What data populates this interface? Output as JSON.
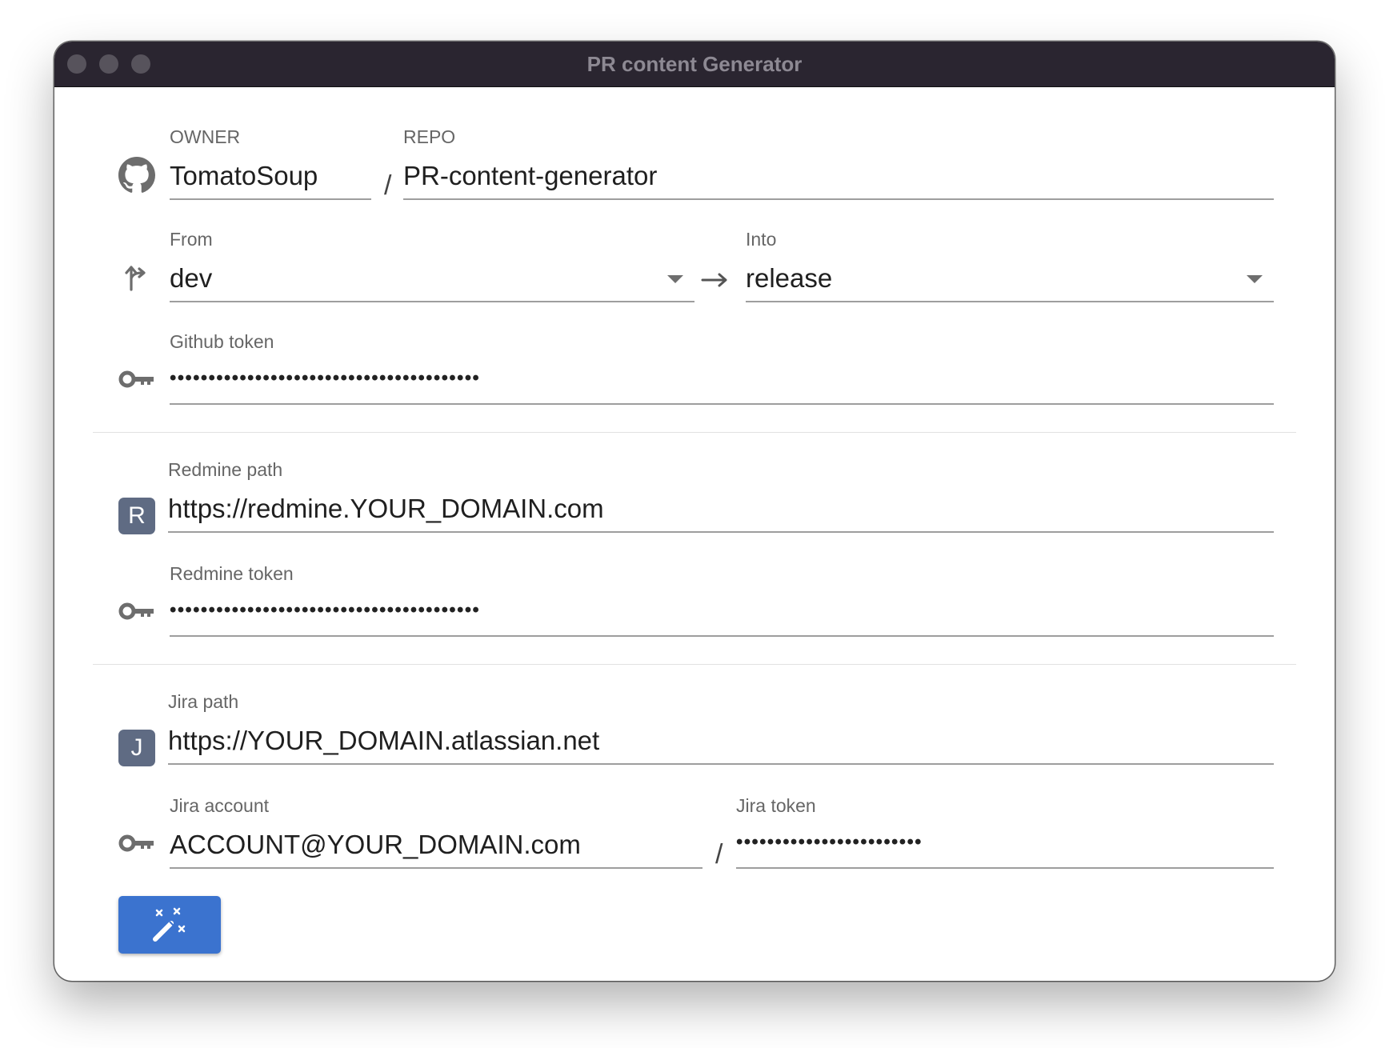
{
  "window": {
    "title": "PR content Generator"
  },
  "github": {
    "icon": "github-icon",
    "owner": {
      "label": "OWNER",
      "value": "TomatoSoup"
    },
    "separator": "/",
    "repo": {
      "label": "REPO",
      "value": "PR-content-generator"
    }
  },
  "branches": {
    "icon": "branch-merge-icon",
    "from": {
      "label": "From",
      "value": "dev"
    },
    "arrow_icon": "arrow-right-icon",
    "into": {
      "label": "Into",
      "value": "release"
    }
  },
  "github_token": {
    "icon": "key-icon",
    "label": "Github token",
    "masked_value": "••••••••••••••••••••••••••••••••••••••••"
  },
  "redmine": {
    "avatar_letter": "R",
    "path": {
      "label": "Redmine path",
      "value": "https://redmine.YOUR_DOMAIN.com"
    },
    "token": {
      "icon": "key-icon",
      "label": "Redmine token",
      "masked_value": "••••••••••••••••••••••••••••••••••••••••"
    }
  },
  "jira": {
    "avatar_letter": "J",
    "path": {
      "label": "Jira path",
      "value": "https://YOUR_DOMAIN.atlassian.net"
    },
    "account": {
      "icon": "key-icon",
      "label": "Jira account",
      "value": "ACCOUNT@YOUR_DOMAIN.com"
    },
    "separator": "/",
    "token": {
      "label": "Jira token",
      "masked_value": "••••••••••••••••••••••••"
    }
  },
  "generate_button": {
    "icon": "magic-wand-icon"
  },
  "colors": {
    "titlebar": "#2a2530",
    "button": "#3b73cf",
    "avatar": "#5f6b83"
  }
}
